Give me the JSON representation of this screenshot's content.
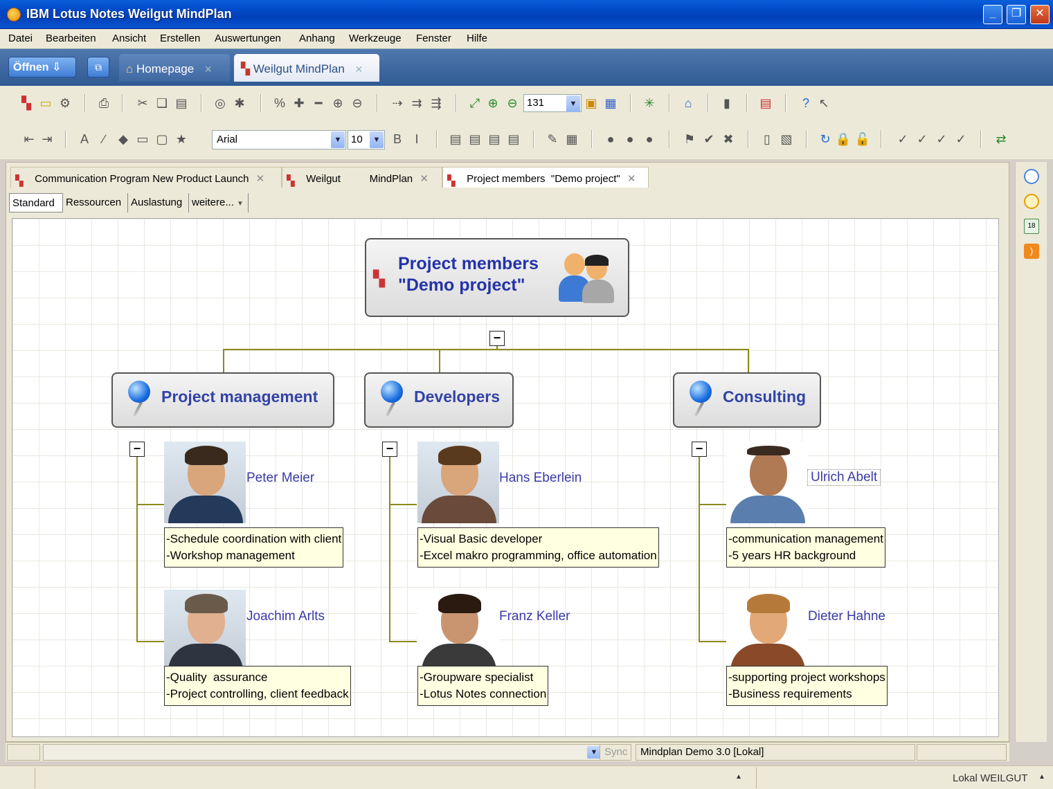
{
  "window": {
    "title": "IBM Lotus Notes Weilgut MindPlan"
  },
  "menu": [
    "Datei",
    "Bearbeiten",
    "Ansicht",
    "Erstellen",
    "Auswertungen",
    "Anhang",
    "Werkzeuge",
    "Fenster",
    "Hilfe"
  ],
  "tabbar": {
    "open_label": "Öffnen",
    "tabs": [
      {
        "label": "Homepage",
        "icon": "home-icon",
        "active": false
      },
      {
        "label": "Weilgut MindPlan",
        "icon": "mindplan-icon",
        "active": true
      }
    ]
  },
  "toolbar": {
    "zoom": "131",
    "font": "Arial",
    "font_size": "10"
  },
  "doc_tabs": [
    {
      "label": "Communication Program New Product Launch",
      "active": false
    },
    {
      "label": "Weilgut          MindPlan",
      "active": false
    },
    {
      "label": "Project members  \"Demo project\"",
      "active": true
    }
  ],
  "view_tabs": [
    "Standard",
    "Ressourcen",
    "Auslastung",
    "weitere..."
  ],
  "mindmap": {
    "root": {
      "line1": "Project members",
      "line2": "\"Demo project\""
    },
    "branches": [
      {
        "label": "Project management",
        "members": [
          {
            "name": "Peter Meier",
            "notes": [
              "-Schedule coordination with client",
              "-Workshop management"
            ]
          },
          {
            "name": "Joachim Arlts",
            "notes": [
              "-Quality  assurance",
              "-Project controlling, client feedback"
            ]
          }
        ]
      },
      {
        "label": "Developers",
        "members": [
          {
            "name": "Hans Eberlein",
            "notes": [
              "-Visual Basic developer",
              "-Excel makro programming, office automation"
            ]
          },
          {
            "name": "Franz Keller",
            "notes": [
              "-Groupware specialist",
              "-Lotus Notes connection"
            ]
          }
        ]
      },
      {
        "label": "Consulting",
        "members": [
          {
            "name": "Ulrich Abelt",
            "notes": [
              "-communication management",
              "-5 years HR background"
            ]
          },
          {
            "name": "Dieter Hahne",
            "notes": [
              "-supporting project workshops",
              "-Business requirements"
            ]
          }
        ]
      }
    ]
  },
  "status": {
    "sync": "Sync",
    "database": "Mindplan Demo 3.0 [Lokal]",
    "location": "Lokal WEILGUT"
  },
  "colors": {
    "node_text": "#3343a6",
    "connector": "#8a8a1c",
    "note_bg": "#ffffe1"
  }
}
